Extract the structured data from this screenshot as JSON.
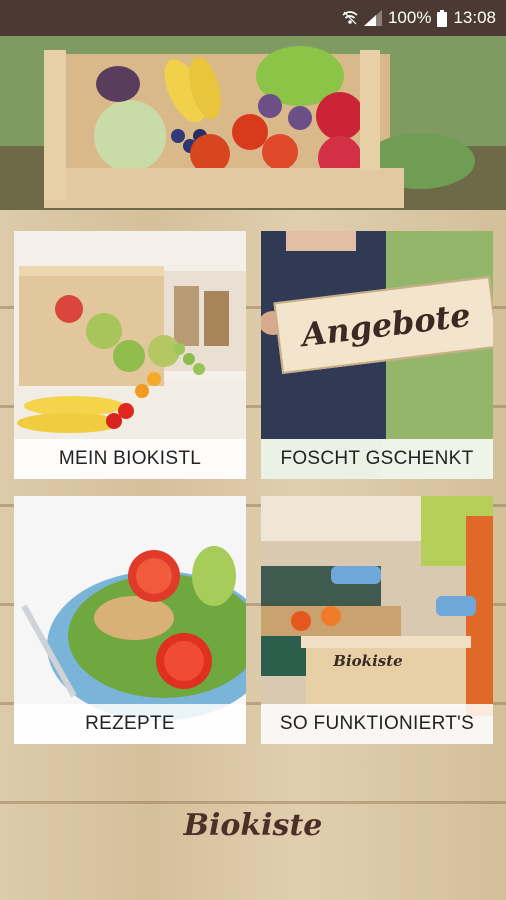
{
  "status_bar": {
    "battery_percent": "100%",
    "time": "13:08",
    "icons": [
      "wifi-icon",
      "signal-icon",
      "battery-icon"
    ]
  },
  "header": {
    "image": "vegetable-crate-photo"
  },
  "tiles": [
    {
      "label": "MEIN BIOKISTL",
      "image": "fruit-crate-photo"
    },
    {
      "label": "FOSCHT GSCHENKT",
      "image": "angebote-sign-photo",
      "sign_text": "Angebote"
    },
    {
      "label": "REZEPTE",
      "image": "salad-bowl-photo"
    },
    {
      "label": "SO FUNKTIONIERT'S",
      "image": "packing-crates-photo",
      "crate_text": "Biokiste"
    }
  ],
  "brand": {
    "logo_text": "Biokiste"
  },
  "colors": {
    "statusbar": "#4a3a33",
    "brand": "#4a3128",
    "wood": "#d9c6a6"
  }
}
